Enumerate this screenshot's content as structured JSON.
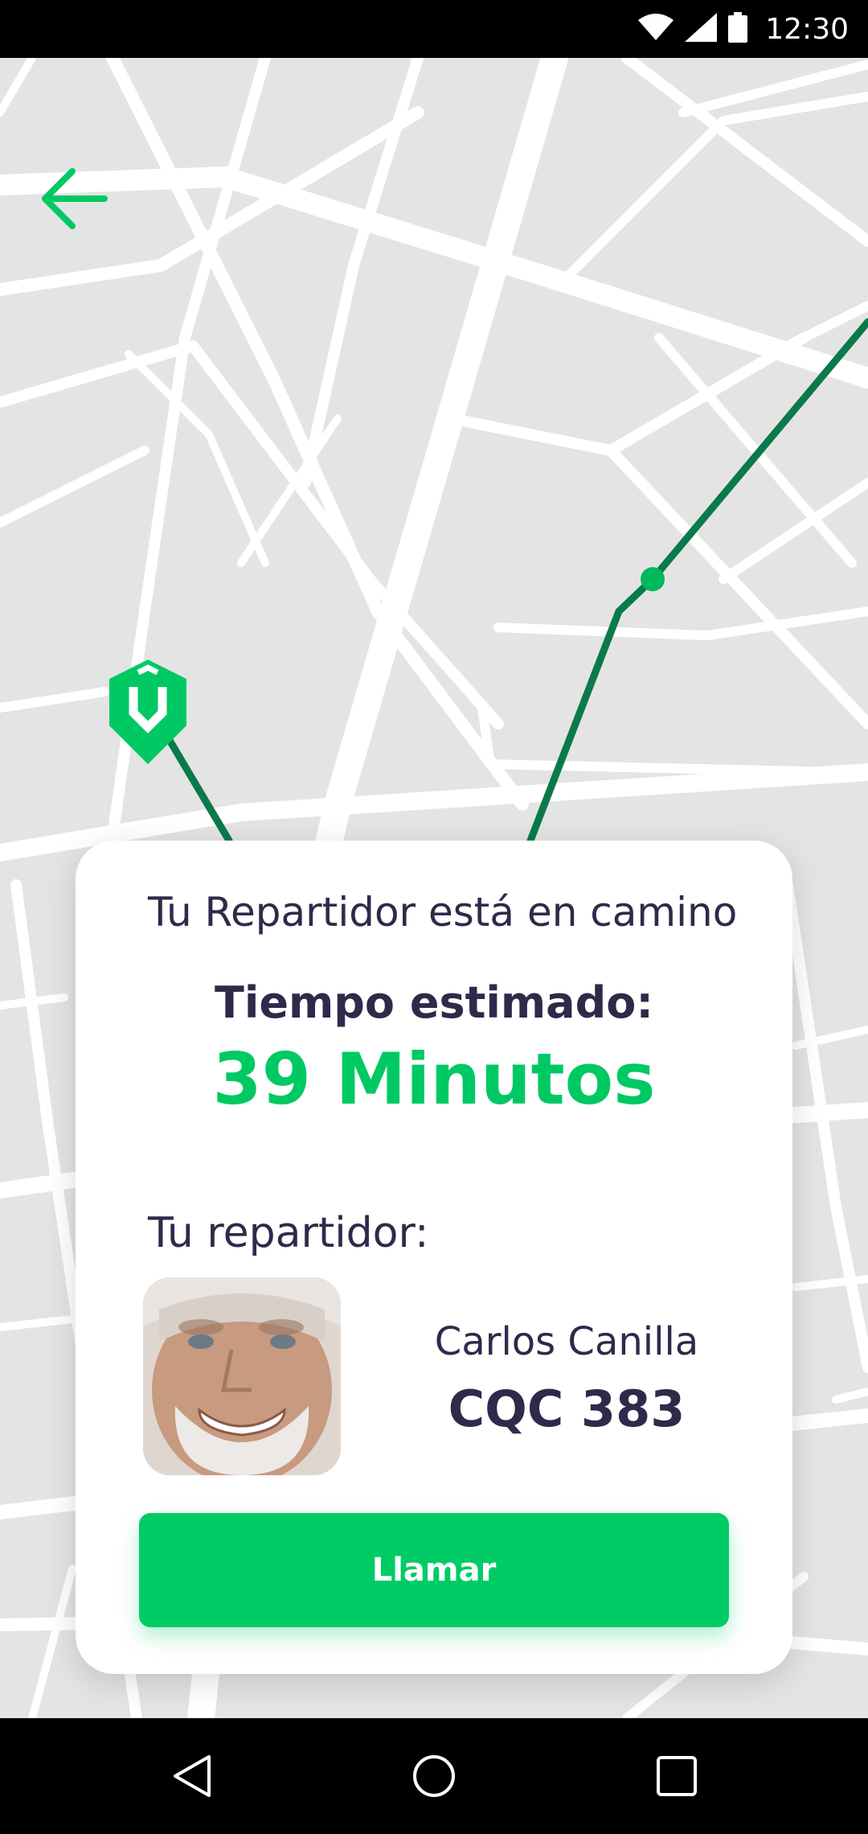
{
  "status_bar": {
    "time": "12:30",
    "icons": [
      "wifi-icon",
      "signal-icon",
      "battery-icon"
    ]
  },
  "navigation": {
    "back_icon": "arrow-left-icon"
  },
  "map": {
    "store_marker_icon": "store-pin-icon",
    "route_color": "#0a7a4a"
  },
  "delivery_card": {
    "title": "Tu Repartidor está en camino",
    "eta_label": "Tiempo estimado:",
    "eta_value": "39 Minutos",
    "courier_label": "Tu repartidor:",
    "courier_name": "Carlos Canilla",
    "courier_plate": "CQC 383",
    "call_button_label": "Llamar"
  },
  "system_nav": {
    "buttons": [
      "back-triangle-icon",
      "home-circle-icon",
      "recents-square-icon"
    ]
  },
  "colors": {
    "accent": "#00cc66",
    "text_dark": "#2e2a4a",
    "route": "#0a7a4a"
  }
}
